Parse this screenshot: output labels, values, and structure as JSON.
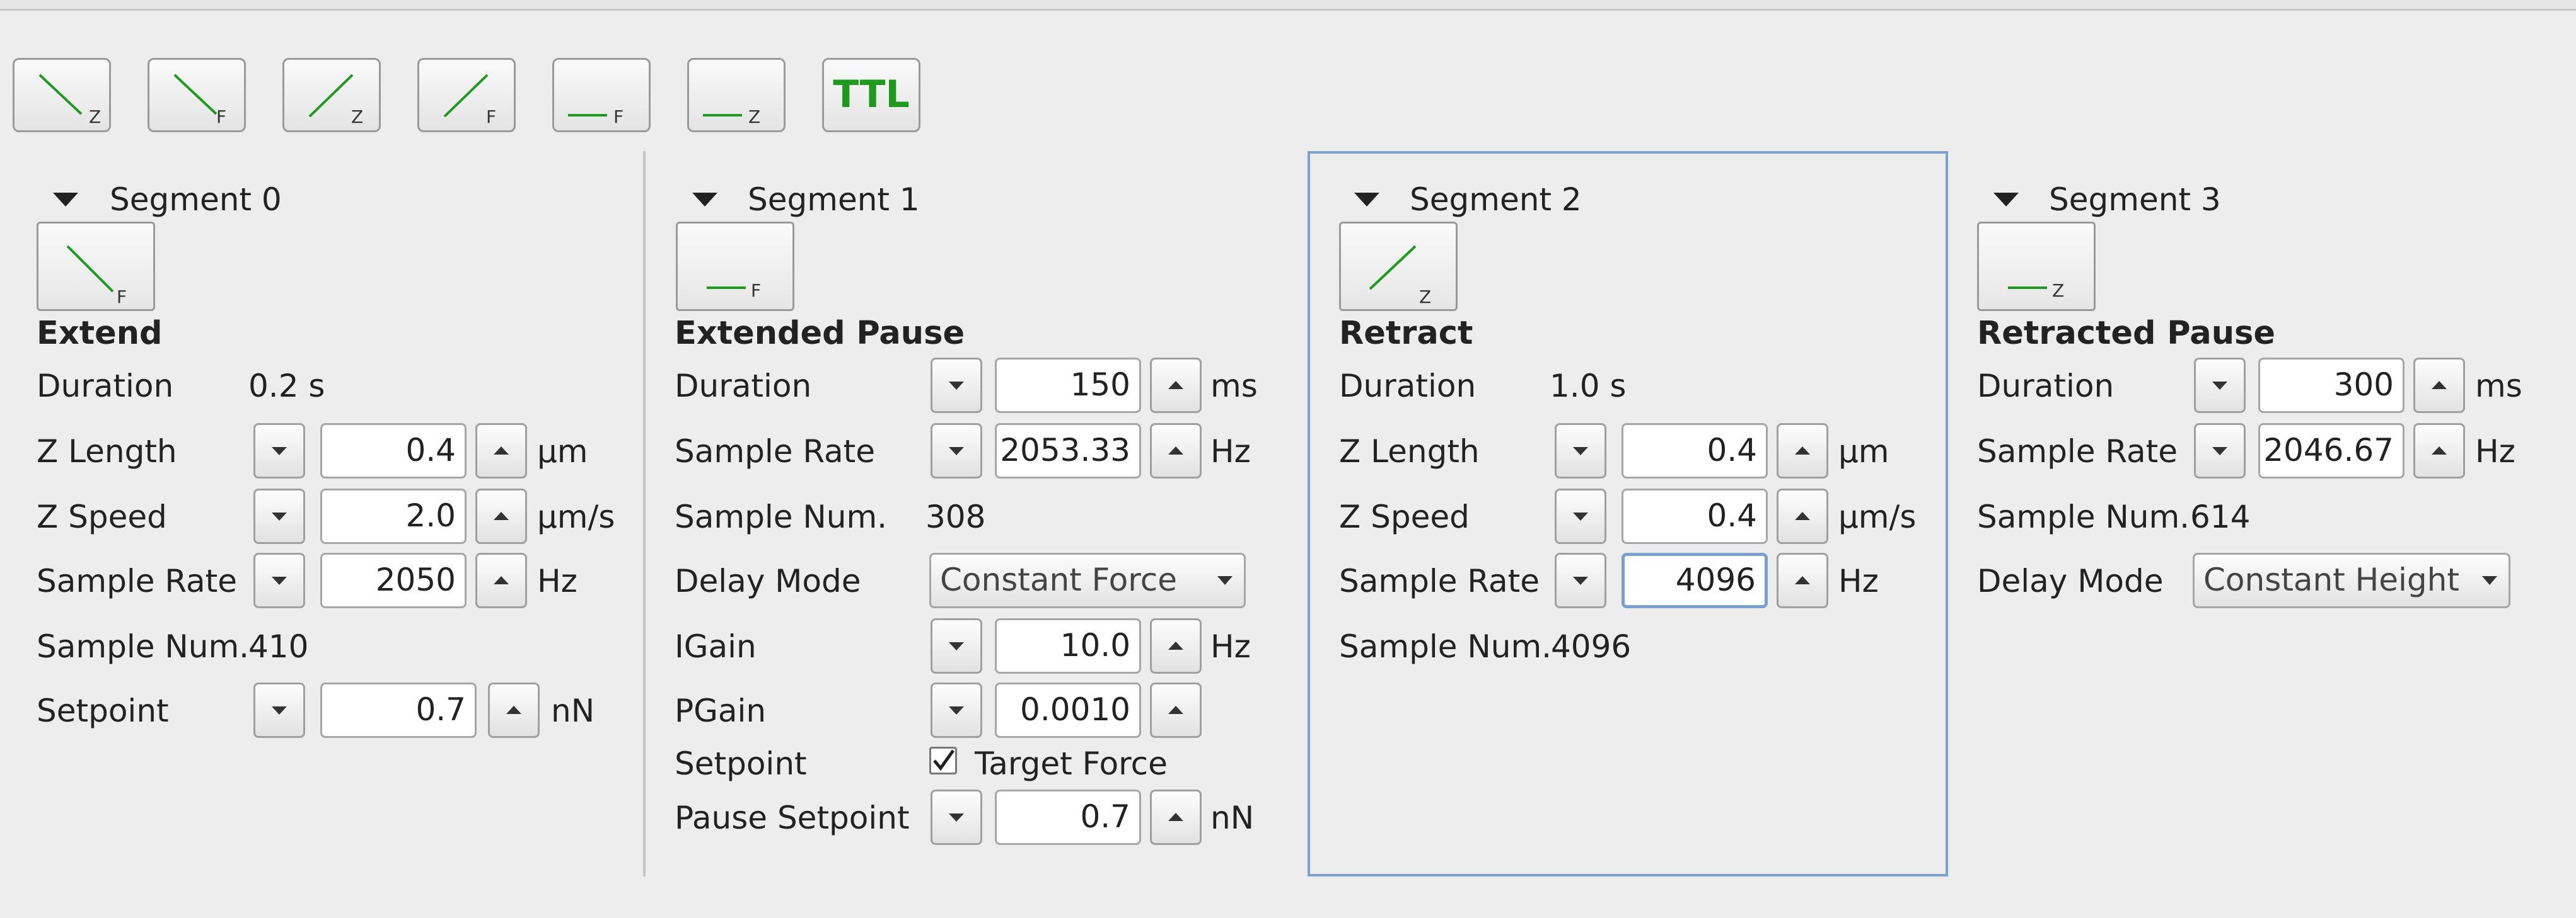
{
  "toolbar": {
    "buttons": [
      {
        "name": "extend-z-button",
        "letter": "Z"
      },
      {
        "name": "extend-f-button",
        "letter": "F"
      },
      {
        "name": "retract-z-button",
        "letter": "Z"
      },
      {
        "name": "retract-f-button",
        "letter": "F"
      },
      {
        "name": "pause-f-button",
        "letter": "F"
      },
      {
        "name": "pause-z-button",
        "letter": "Z"
      },
      {
        "name": "ttl-button",
        "letter": ""
      }
    ],
    "ttl_label": "TTL"
  },
  "colors": {
    "accent_green": "#1f9a1f",
    "focus_blue": "#7da2c9"
  },
  "segments": [
    {
      "header": "Segment 0",
      "icon": "extend-f-icon",
      "icon_letter": "F",
      "name": "Extend",
      "duration_label": "Duration",
      "duration_value": "0.2 s",
      "zlength_label": "Z Length",
      "zlength_value": "0.4",
      "zlength_unit": "µm",
      "zspeed_label": "Z Speed",
      "zspeed_value": "2.0",
      "zspeed_unit": "µm/s",
      "samplerate_label": "Sample Rate",
      "samplerate_value": "2050",
      "samplerate_unit": "Hz",
      "samplenum_label": "Sample Num.",
      "samplenum_value": "410",
      "setpoint_label": "Setpoint",
      "setpoint_value": "0.7",
      "setpoint_unit": "nN"
    },
    {
      "header": "Segment 1",
      "icon": "pause-f-icon",
      "icon_letter": "F",
      "name": "Extended Pause",
      "duration_label": "Duration",
      "duration_value": "150",
      "duration_unit": "ms",
      "samplerate_label": "Sample Rate",
      "samplerate_value": "2053.33",
      "samplerate_unit": "Hz",
      "samplenum_label": "Sample Num.",
      "samplenum_value": "308",
      "delaymode_label": "Delay Mode",
      "delaymode_value": "Constant Force",
      "igain_label": "IGain",
      "igain_value": "10.0",
      "igain_unit": "Hz",
      "pgain_label": "PGain",
      "pgain_value": "0.0010",
      "setpoint_label": "Setpoint",
      "target_force_label": "Target Force",
      "target_force_checked": true,
      "pause_setpoint_label": "Pause Setpoint",
      "pause_setpoint_value": "0.7",
      "pause_setpoint_unit": "nN"
    },
    {
      "header": "Segment 2",
      "icon": "retract-z-icon",
      "icon_letter": "Z",
      "name": "Retract",
      "duration_label": "Duration",
      "duration_value": "1.0 s",
      "zlength_label": "Z Length",
      "zlength_value": "0.4",
      "zlength_unit": "µm",
      "zspeed_label": "Z Speed",
      "zspeed_value": "0.4",
      "zspeed_unit": "µm/s",
      "samplerate_label": "Sample Rate",
      "samplerate_value": "4096",
      "samplerate_unit": "Hz",
      "samplenum_label": "Sample Num.",
      "samplenum_value": "4096"
    },
    {
      "header": "Segment 3",
      "icon": "pause-z-icon",
      "icon_letter": "Z",
      "name": "Retracted Pause",
      "duration_label": "Duration",
      "duration_value": "300",
      "duration_unit": "ms",
      "samplerate_label": "Sample Rate",
      "samplerate_value": "2046.67",
      "samplerate_unit": "Hz",
      "samplenum_label": "Sample Num.",
      "samplenum_value": "614",
      "delaymode_label": "Delay Mode",
      "delaymode_value": "Constant Height"
    }
  ]
}
